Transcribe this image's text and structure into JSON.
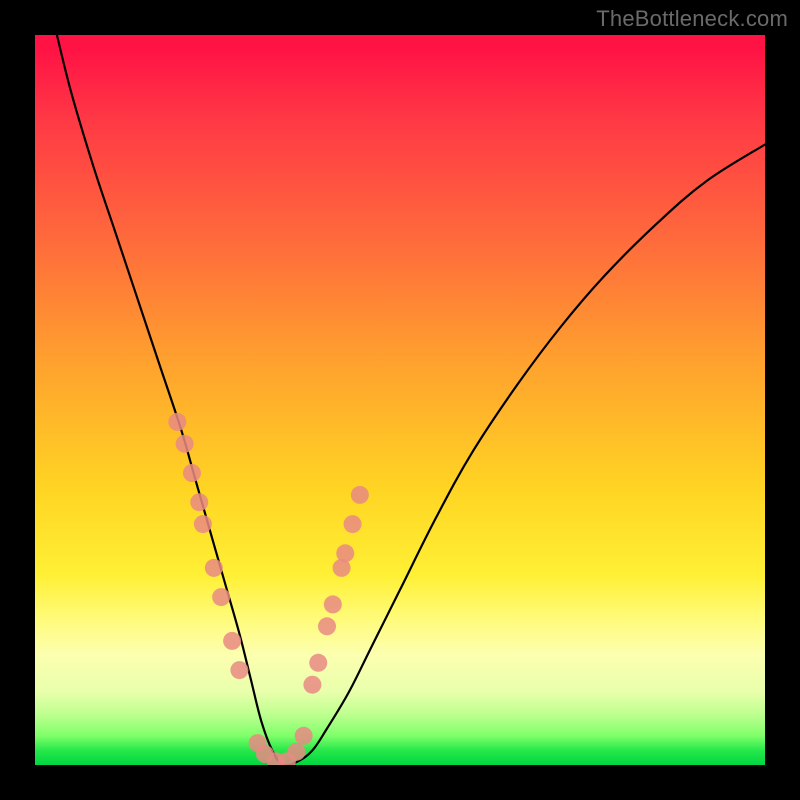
{
  "watermark": "TheBottleneck.com",
  "chart_data": {
    "type": "line",
    "title": "",
    "xlabel": "",
    "ylabel": "",
    "xlim": [
      0,
      100
    ],
    "ylim": [
      0,
      100
    ],
    "grid": false,
    "legend": false,
    "series": [
      {
        "name": "bottleneck-curve",
        "color": "#000000",
        "x": [
          3,
          5,
          8,
          11,
          14,
          17,
          20,
          22,
          24,
          26,
          28,
          29.5,
          31,
          32.5,
          34,
          36,
          38,
          40,
          43,
          46,
          50,
          55,
          60,
          66,
          72,
          78,
          85,
          92,
          100
        ],
        "values": [
          100,
          92,
          82,
          73,
          64,
          55,
          46,
          39,
          32,
          25,
          18,
          12,
          6,
          2,
          0,
          0.5,
          2,
          5,
          10,
          16,
          24,
          34,
          43,
          52,
          60,
          67,
          74,
          80,
          85
        ]
      }
    ],
    "markers": [
      {
        "name": "left-cluster",
        "color": "#e98a84",
        "points": [
          {
            "x": 19.5,
            "y": 47
          },
          {
            "x": 20.5,
            "y": 44
          },
          {
            "x": 21.5,
            "y": 40
          },
          {
            "x": 22.5,
            "y": 36
          },
          {
            "x": 23.0,
            "y": 33
          },
          {
            "x": 24.5,
            "y": 27
          },
          {
            "x": 25.5,
            "y": 23
          },
          {
            "x": 27.0,
            "y": 17
          },
          {
            "x": 28.0,
            "y": 13
          }
        ]
      },
      {
        "name": "right-cluster",
        "color": "#e98a84",
        "points": [
          {
            "x": 38.0,
            "y": 11
          },
          {
            "x": 38.8,
            "y": 14
          },
          {
            "x": 40.0,
            "y": 19
          },
          {
            "x": 40.8,
            "y": 22
          },
          {
            "x": 42.0,
            "y": 27
          },
          {
            "x": 42.5,
            "y": 29
          },
          {
            "x": 43.5,
            "y": 33
          },
          {
            "x": 44.5,
            "y": 37
          }
        ]
      },
      {
        "name": "bottom-cluster",
        "color": "#e98a84",
        "points": [
          {
            "x": 30.5,
            "y": 3
          },
          {
            "x": 31.5,
            "y": 1.5
          },
          {
            "x": 33.0,
            "y": 0.5
          },
          {
            "x": 34.5,
            "y": 0.5
          },
          {
            "x": 35.8,
            "y": 1.8
          },
          {
            "x": 36.8,
            "y": 4
          }
        ]
      }
    ]
  }
}
